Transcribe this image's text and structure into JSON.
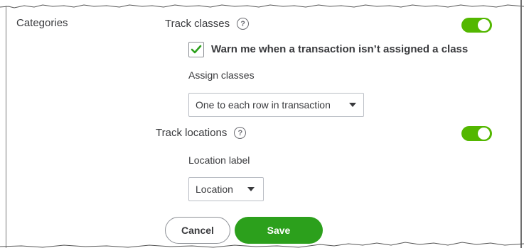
{
  "section": {
    "label": "Categories"
  },
  "track_classes": {
    "label": "Track classes",
    "help_icon": "question-circle-icon",
    "toggle_on": true,
    "warn_checkbox": {
      "checked": true,
      "label": "Warn me when a transaction isn’t assigned a class"
    },
    "assign": {
      "label": "Assign classes",
      "selected": "One to each row in transaction"
    }
  },
  "track_locations": {
    "label": "Track locations",
    "help_icon": "question-circle-icon",
    "toggle_on": true,
    "location_label": {
      "label": "Location label",
      "selected": "Location"
    }
  },
  "actions": {
    "cancel_label": "Cancel",
    "save_label": "Save"
  },
  "colors": {
    "toggle_on": "#53b700",
    "save_button": "#2ca01c",
    "checkmark": "#2ca01c",
    "text": "#393a3d"
  }
}
